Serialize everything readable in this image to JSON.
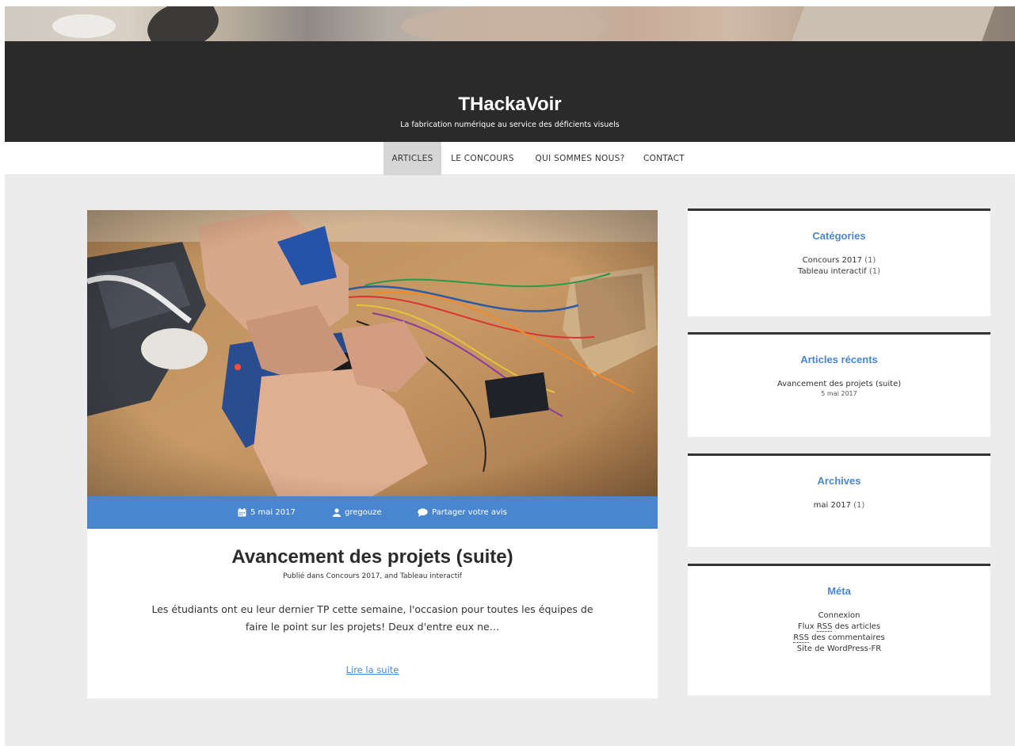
{
  "site": {
    "title": "THackaVoir",
    "tagline": "La fabrication numérique au service des déficients visuels"
  },
  "nav": {
    "items": [
      {
        "label": "ARTICLES",
        "active": true
      },
      {
        "label": "LE CONCOURS",
        "active": false
      },
      {
        "label": "QUI SOMMES NOUS?",
        "active": false
      },
      {
        "label": "CONTACT",
        "active": false
      }
    ]
  },
  "post": {
    "date": "5 mai 2017",
    "author": "gregouze",
    "comment_link": "Partager votre avis",
    "title": "Avancement des projets (suite)",
    "categories_line": "Publié dans Concours 2017, and Tableau interactif",
    "excerpt": "Les étudiants ont eu leur dernier TP cette semaine, l'occasion pour toutes les équipes de faire le point sur les projets! Deux d'entre eux ne…",
    "read_more": "Lire la suite",
    "icons": {
      "date": "calendar-icon",
      "author": "user-icon",
      "comments": "comment-bubble-icon"
    }
  },
  "widgets": {
    "categories": {
      "title": "Catégories",
      "items": [
        {
          "label": "Concours 2017",
          "count": "(1)"
        },
        {
          "label": "Tableau interactif",
          "count": "(1)"
        }
      ]
    },
    "recent": {
      "title": "Articles récents",
      "items": [
        {
          "label": "Avancement des projets (suite)",
          "date": "5 mai 2017"
        }
      ]
    },
    "archives": {
      "title": "Archives",
      "items": [
        {
          "label": "mai 2017",
          "count": "(1)"
        }
      ]
    },
    "meta": {
      "title": "Méta",
      "login": "Connexion",
      "feed_prefix": "Flux ",
      "feed_rss": "RSS",
      "feed_suffix": " des articles",
      "comments_rss": "RSS",
      "comments_suffix": " des commentaires",
      "wordpress": "Site de WordPress-FR"
    }
  },
  "colors": {
    "accent": "#4a86cf",
    "header_bg": "#2a2a2a",
    "content_bg": "#ececec"
  }
}
